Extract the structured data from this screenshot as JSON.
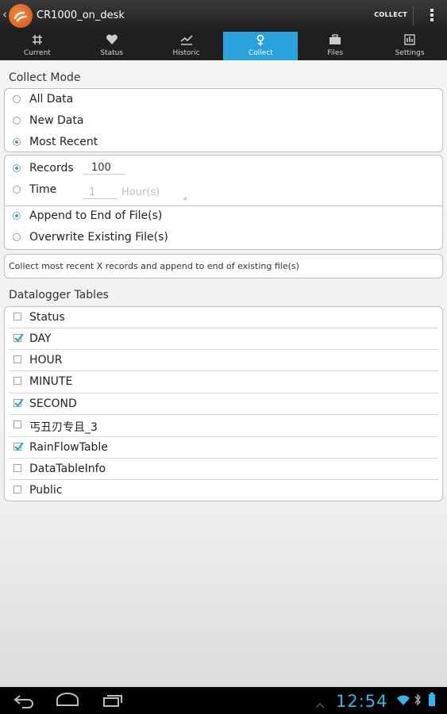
{
  "app": {
    "title": "CR1000_on_desk",
    "collect_label": "COLLECT"
  },
  "tabs": [
    {
      "label": "Current",
      "icon": "hash-icon"
    },
    {
      "label": "Status",
      "icon": "heart-icon"
    },
    {
      "label": "Historic",
      "icon": "historic-chart-icon"
    },
    {
      "label": "Collect",
      "icon": "collect-icon",
      "active": true
    },
    {
      "label": "Files",
      "icon": "briefcase-icon"
    },
    {
      "label": "Settings",
      "icon": "settings-icon"
    }
  ],
  "collect_mode": {
    "title": "Collect Mode",
    "options": [
      {
        "label": "All Data",
        "selected": false
      },
      {
        "label": "New Data",
        "selected": false
      },
      {
        "label": "Most Recent",
        "selected": true
      }
    ]
  },
  "records": {
    "records_label": "Records",
    "records_value": "100",
    "time_label": "Time",
    "time_value": "1",
    "time_unit": "Hour(s)",
    "records_selected": true
  },
  "file_mode": {
    "options": [
      {
        "label": "Append to End of File(s)",
        "selected": true
      },
      {
        "label": "Overwrite Existing File(s)",
        "selected": false
      }
    ]
  },
  "description": "Collect most recent X records and append to end of existing file(s)",
  "tables": {
    "title": "Datalogger Tables",
    "items": [
      {
        "label": "Status",
        "checked": false
      },
      {
        "label": "DAY",
        "checked": true
      },
      {
        "label": "HOUR",
        "checked": false
      },
      {
        "label": "MINUTE",
        "checked": false
      },
      {
        "label": "SECOND",
        "checked": true
      },
      {
        "label": "丐丑刃专且_3",
        "checked": false
      },
      {
        "label": "RainFlowTable",
        "checked": true
      },
      {
        "label": "DataTableInfo",
        "checked": false
      },
      {
        "label": "Public",
        "checked": false
      }
    ]
  },
  "status_bar": {
    "time": "12:54",
    "icons": [
      "wifi-icon",
      "bluetooth-icon",
      "battery-icon"
    ]
  },
  "nav": {
    "icons": [
      "back-icon",
      "home-icon",
      "recent-apps-icon"
    ]
  },
  "colors": {
    "accent": "#2aa3dc",
    "clock": "#33b5e5"
  }
}
